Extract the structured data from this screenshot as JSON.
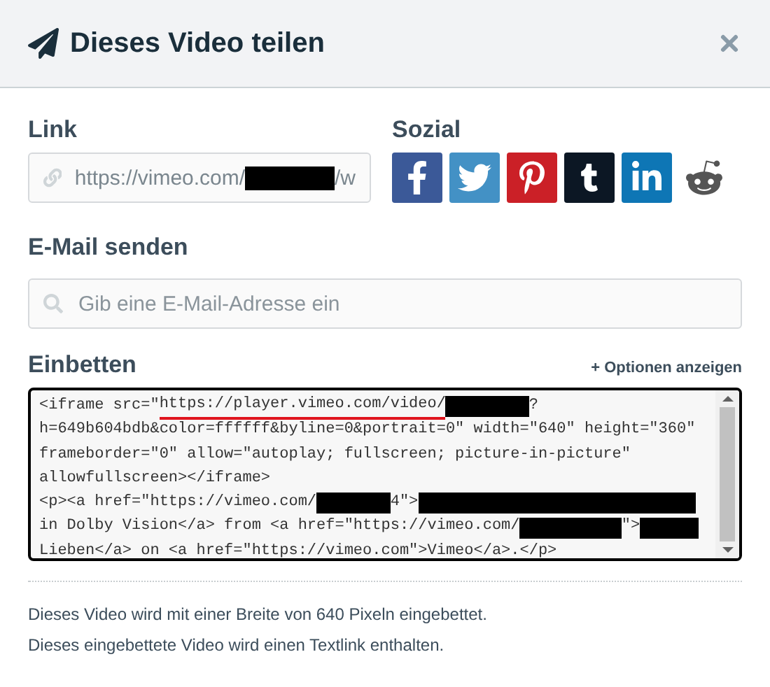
{
  "dialog": {
    "title": "Dieses Video teilen"
  },
  "link": {
    "label": "Link",
    "segments": [
      {
        "kind": "text",
        "text": "https://vimeo.com/"
      },
      {
        "kind": "redacted"
      },
      {
        "kind": "text",
        "text": "/w"
      }
    ]
  },
  "social": {
    "label": "Sozial",
    "items": [
      {
        "kind": "facebook",
        "color": "#3b5998"
      },
      {
        "kind": "twitter",
        "color": "#4391c5"
      },
      {
        "kind": "pinterest",
        "color": "#cb2027"
      },
      {
        "kind": "tumblr",
        "color": "#0c1724"
      },
      {
        "kind": "linkedin",
        "color": "#0e76b5"
      },
      {
        "kind": "reddit",
        "color": "#ffffff"
      }
    ]
  },
  "email": {
    "label": "E-Mail senden",
    "placeholder": "Gib eine E-Mail-Adresse ein"
  },
  "embed": {
    "label": "Einbetten",
    "options_link": "+ Optionen anzeigen",
    "lines": [
      [
        {
          "kind": "text",
          "text": "<iframe src=\""
        },
        {
          "kind": "marked",
          "text": "https://player.vimeo.com/video/"
        },
        {
          "kind": "redacted"
        },
        {
          "kind": "text",
          "text": "?"
        }
      ],
      [
        {
          "kind": "text",
          "text": "h=649b604bdb&color=ffffff&byline=0&portrait=0\" width=\"640\" height=\"360\""
        }
      ],
      [
        {
          "kind": "text",
          "text": "frameborder=\"0\" allow=\"autoplay; fullscreen; picture-in-picture\""
        }
      ],
      [
        {
          "kind": "text",
          "text": "allowfullscreen></iframe>"
        }
      ],
      [
        {
          "kind": "text",
          "text": "<p><a href=\"https://vimeo.com/"
        },
        {
          "kind": "redacted"
        },
        {
          "kind": "text",
          "text": "4\">"
        },
        {
          "kind": "redacted"
        }
      ],
      [
        {
          "kind": "text",
          "text": "in Dolby Vision</a> from <a href=\"https://vimeo.com/"
        },
        {
          "kind": "redacted"
        },
        {
          "kind": "text",
          "text": "\">"
        },
        {
          "kind": "redacted"
        }
      ],
      [
        {
          "kind": "text",
          "text": "Lieben</a> on <a href=\"https://vimeo.com\">Vimeo</a>.</p>"
        }
      ]
    ]
  },
  "notes": [
    "Dieses Video wird mit einer Breite von 640 Pixeln eingebettet.",
    "Dieses eingebettete Video wird einen Textlink enthalten."
  ]
}
